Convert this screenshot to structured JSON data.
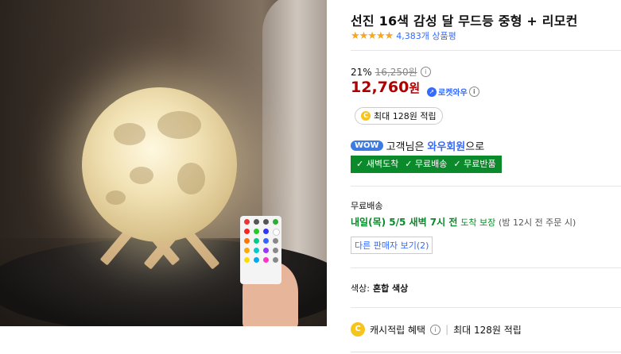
{
  "product": {
    "title": "선진 16색 감성 달 무드등 중형 + 리모컨",
    "rating_stars": "★★★★★",
    "rating_value": 4.5,
    "review_count": "4,383개 상품평"
  },
  "price": {
    "discount_rate": "21%",
    "original_price": "16,250원",
    "sale_price": "12,760",
    "currency": "원",
    "rocket_label": "로켓와우"
  },
  "cash": {
    "coin_symbol": "C",
    "max_reward": "최대 128원 적립"
  },
  "wow": {
    "badge": "WOW",
    "text_prefix": "고객님은",
    "link": "와우회원",
    "text_suffix": "으로",
    "benefits": [
      "✓ 새벽도착",
      "✓ 무료배송",
      "✓ 무료반품"
    ],
    "benefit_color": "#0a8a2a"
  },
  "shipping": {
    "title": "무료배송",
    "date": "내일(목) 5/5 새벽 7시 전",
    "guarantee": "도착 보장",
    "condition": "(밤 12시 전 주문 시)",
    "other_sellers": "다른 판매자 보기(2)"
  },
  "option": {
    "label": "색상:",
    "value": "혼합 색상"
  },
  "cashback": {
    "label": "캐시적립 혜택",
    "separator": "|",
    "amount": "최대 128원 적립"
  },
  "colors": {
    "price": "#ae0000",
    "link": "#346aff",
    "star": "#f5a623"
  }
}
